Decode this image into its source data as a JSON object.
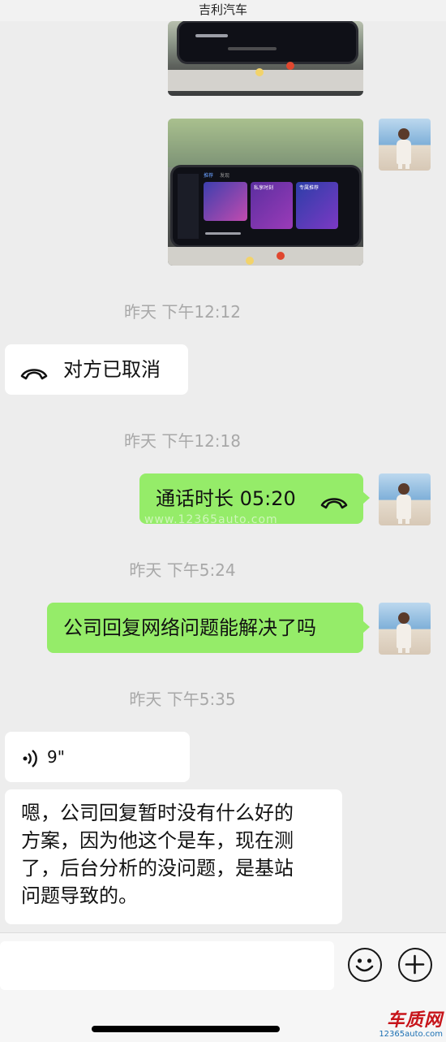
{
  "header": {
    "title": "吉利汽车"
  },
  "timestamps": [
    "昨天 下午12:12",
    "昨天 下午12:18",
    "昨天 下午5:24",
    "昨天 下午5:35"
  ],
  "messages": {
    "call_cancelled": "对方已取消",
    "call_duration": "通话时长 05:20",
    "question": "公司回复网络问题能解决了吗",
    "voice_duration": "9\"",
    "reply_line1": "嗯，公司回复暂时没有什么好的",
    "reply_line2": "方案，因为他这个是车，现在测",
    "reply_line3": "了，后台分析的没问题，是基站",
    "reply_line4": "问题导致的。"
  },
  "photo_labels": {
    "tab_recommend": "推荐",
    "tab_discover": "发现",
    "card_title": "私享时刻",
    "card_title2": "专属推荐"
  },
  "watermark": {
    "text": "www.12365auto.com"
  },
  "logo": {
    "name": "车质网",
    "url": "12365auto.com"
  },
  "icons": {
    "phone": "phone-hangup-icon",
    "voice": "voice-wave-icon",
    "emoji": "emoji-face-icon",
    "plus": "plus-icon"
  },
  "colors": {
    "background": "#ededed",
    "self_bubble": "#95ec69",
    "other_bubble": "#ffffff",
    "timestamp": "#a8a8a8"
  }
}
